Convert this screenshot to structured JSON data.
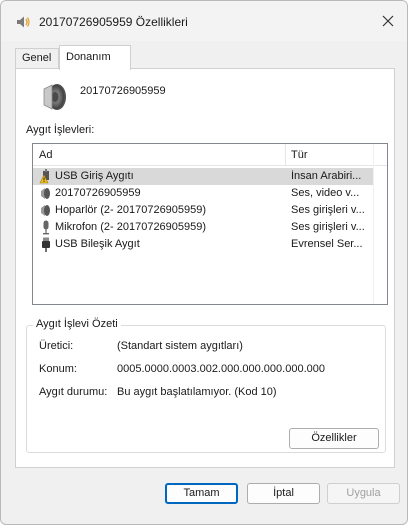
{
  "window": {
    "title": "20170726905959 Özellikleri",
    "icon": "speaker-icon"
  },
  "tabs": [
    {
      "label": "Genel",
      "active": false
    },
    {
      "label": "Donanım",
      "active": true
    }
  ],
  "device": {
    "name": "20170726905959",
    "icon": "speaker-icon"
  },
  "functions": {
    "label": "Aygıt İşlevleri:",
    "columns": [
      "Ad",
      "Tür"
    ],
    "rows": [
      {
        "name": "USB Giriş Aygıtı",
        "type": "İnsan Arabiri...",
        "icon": "warning-hid-icon",
        "selected": true
      },
      {
        "name": "20170726905959",
        "type": "Ses, video v...",
        "icon": "speaker-icon",
        "selected": false
      },
      {
        "name": "Hoparlör (2- 20170726905959)",
        "type": "Ses girişleri v...",
        "icon": "speaker-icon",
        "selected": false
      },
      {
        "name": "Mikrofon (2- 20170726905959)",
        "type": "Ses girişleri v...",
        "icon": "microphone-icon",
        "selected": false
      },
      {
        "name": "USB Bileşik Aygıt",
        "type": "Evrensel Ser...",
        "icon": "usb-icon",
        "selected": false
      }
    ]
  },
  "summary": {
    "title": "Aygıt İşlevi Özeti",
    "manufacturer_label": "Üretici:",
    "manufacturer_value": "(Standart sistem aygıtları)",
    "location_label": "Konum:",
    "location_value": "0005.0000.0003.002.000.000.000.000.000",
    "status_label": "Aygıt durumu:",
    "status_value": "Bu aygıt başlatılamıyor. (Kod 10)",
    "properties_button": "Özellikler"
  },
  "buttons": {
    "ok": "Tamam",
    "cancel": "İptal",
    "apply": "Uygula"
  },
  "colors": {
    "accent": "#0067c0",
    "selection": "#d9d9d9"
  }
}
